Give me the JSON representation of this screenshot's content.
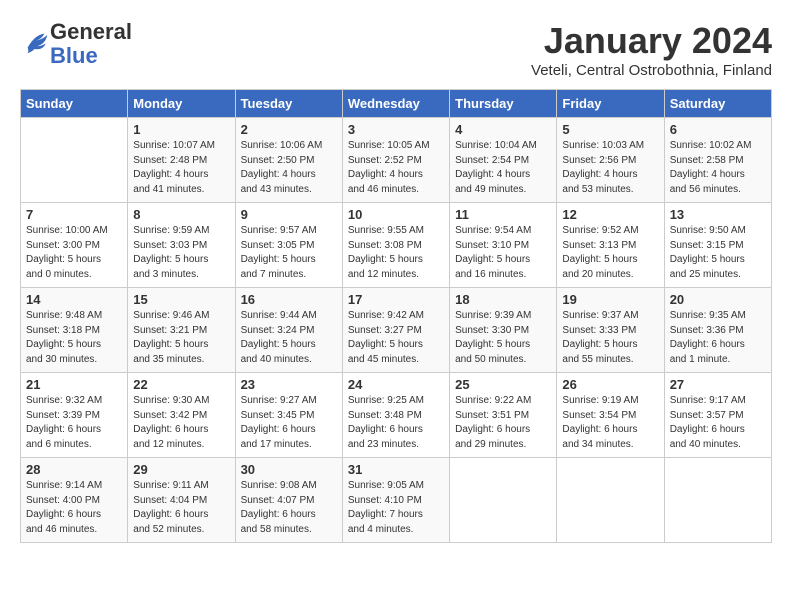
{
  "header": {
    "logo_line1": "General",
    "logo_line2": "Blue",
    "month": "January 2024",
    "location": "Veteli, Central Ostrobothnia, Finland"
  },
  "days_of_week": [
    "Sunday",
    "Monday",
    "Tuesday",
    "Wednesday",
    "Thursday",
    "Friday",
    "Saturday"
  ],
  "weeks": [
    [
      {
        "day": "",
        "info": ""
      },
      {
        "day": "1",
        "info": "Sunrise: 10:07 AM\nSunset: 2:48 PM\nDaylight: 4 hours\nand 41 minutes."
      },
      {
        "day": "2",
        "info": "Sunrise: 10:06 AM\nSunset: 2:50 PM\nDaylight: 4 hours\nand 43 minutes."
      },
      {
        "day": "3",
        "info": "Sunrise: 10:05 AM\nSunset: 2:52 PM\nDaylight: 4 hours\nand 46 minutes."
      },
      {
        "day": "4",
        "info": "Sunrise: 10:04 AM\nSunset: 2:54 PM\nDaylight: 4 hours\nand 49 minutes."
      },
      {
        "day": "5",
        "info": "Sunrise: 10:03 AM\nSunset: 2:56 PM\nDaylight: 4 hours\nand 53 minutes."
      },
      {
        "day": "6",
        "info": "Sunrise: 10:02 AM\nSunset: 2:58 PM\nDaylight: 4 hours\nand 56 minutes."
      }
    ],
    [
      {
        "day": "7",
        "info": "Sunrise: 10:00 AM\nSunset: 3:00 PM\nDaylight: 5 hours\nand 0 minutes."
      },
      {
        "day": "8",
        "info": "Sunrise: 9:59 AM\nSunset: 3:03 PM\nDaylight: 5 hours\nand 3 minutes."
      },
      {
        "day": "9",
        "info": "Sunrise: 9:57 AM\nSunset: 3:05 PM\nDaylight: 5 hours\nand 7 minutes."
      },
      {
        "day": "10",
        "info": "Sunrise: 9:55 AM\nSunset: 3:08 PM\nDaylight: 5 hours\nand 12 minutes."
      },
      {
        "day": "11",
        "info": "Sunrise: 9:54 AM\nSunset: 3:10 PM\nDaylight: 5 hours\nand 16 minutes."
      },
      {
        "day": "12",
        "info": "Sunrise: 9:52 AM\nSunset: 3:13 PM\nDaylight: 5 hours\nand 20 minutes."
      },
      {
        "day": "13",
        "info": "Sunrise: 9:50 AM\nSunset: 3:15 PM\nDaylight: 5 hours\nand 25 minutes."
      }
    ],
    [
      {
        "day": "14",
        "info": "Sunrise: 9:48 AM\nSunset: 3:18 PM\nDaylight: 5 hours\nand 30 minutes."
      },
      {
        "day": "15",
        "info": "Sunrise: 9:46 AM\nSunset: 3:21 PM\nDaylight: 5 hours\nand 35 minutes."
      },
      {
        "day": "16",
        "info": "Sunrise: 9:44 AM\nSunset: 3:24 PM\nDaylight: 5 hours\nand 40 minutes."
      },
      {
        "day": "17",
        "info": "Sunrise: 9:42 AM\nSunset: 3:27 PM\nDaylight: 5 hours\nand 45 minutes."
      },
      {
        "day": "18",
        "info": "Sunrise: 9:39 AM\nSunset: 3:30 PM\nDaylight: 5 hours\nand 50 minutes."
      },
      {
        "day": "19",
        "info": "Sunrise: 9:37 AM\nSunset: 3:33 PM\nDaylight: 5 hours\nand 55 minutes."
      },
      {
        "day": "20",
        "info": "Sunrise: 9:35 AM\nSunset: 3:36 PM\nDaylight: 6 hours\nand 1 minute."
      }
    ],
    [
      {
        "day": "21",
        "info": "Sunrise: 9:32 AM\nSunset: 3:39 PM\nDaylight: 6 hours\nand 6 minutes."
      },
      {
        "day": "22",
        "info": "Sunrise: 9:30 AM\nSunset: 3:42 PM\nDaylight: 6 hours\nand 12 minutes."
      },
      {
        "day": "23",
        "info": "Sunrise: 9:27 AM\nSunset: 3:45 PM\nDaylight: 6 hours\nand 17 minutes."
      },
      {
        "day": "24",
        "info": "Sunrise: 9:25 AM\nSunset: 3:48 PM\nDaylight: 6 hours\nand 23 minutes."
      },
      {
        "day": "25",
        "info": "Sunrise: 9:22 AM\nSunset: 3:51 PM\nDaylight: 6 hours\nand 29 minutes."
      },
      {
        "day": "26",
        "info": "Sunrise: 9:19 AM\nSunset: 3:54 PM\nDaylight: 6 hours\nand 34 minutes."
      },
      {
        "day": "27",
        "info": "Sunrise: 9:17 AM\nSunset: 3:57 PM\nDaylight: 6 hours\nand 40 minutes."
      }
    ],
    [
      {
        "day": "28",
        "info": "Sunrise: 9:14 AM\nSunset: 4:00 PM\nDaylight: 6 hours\nand 46 minutes."
      },
      {
        "day": "29",
        "info": "Sunrise: 9:11 AM\nSunset: 4:04 PM\nDaylight: 6 hours\nand 52 minutes."
      },
      {
        "day": "30",
        "info": "Sunrise: 9:08 AM\nSunset: 4:07 PM\nDaylight: 6 hours\nand 58 minutes."
      },
      {
        "day": "31",
        "info": "Sunrise: 9:05 AM\nSunset: 4:10 PM\nDaylight: 7 hours\nand 4 minutes."
      },
      {
        "day": "",
        "info": ""
      },
      {
        "day": "",
        "info": ""
      },
      {
        "day": "",
        "info": ""
      }
    ]
  ]
}
